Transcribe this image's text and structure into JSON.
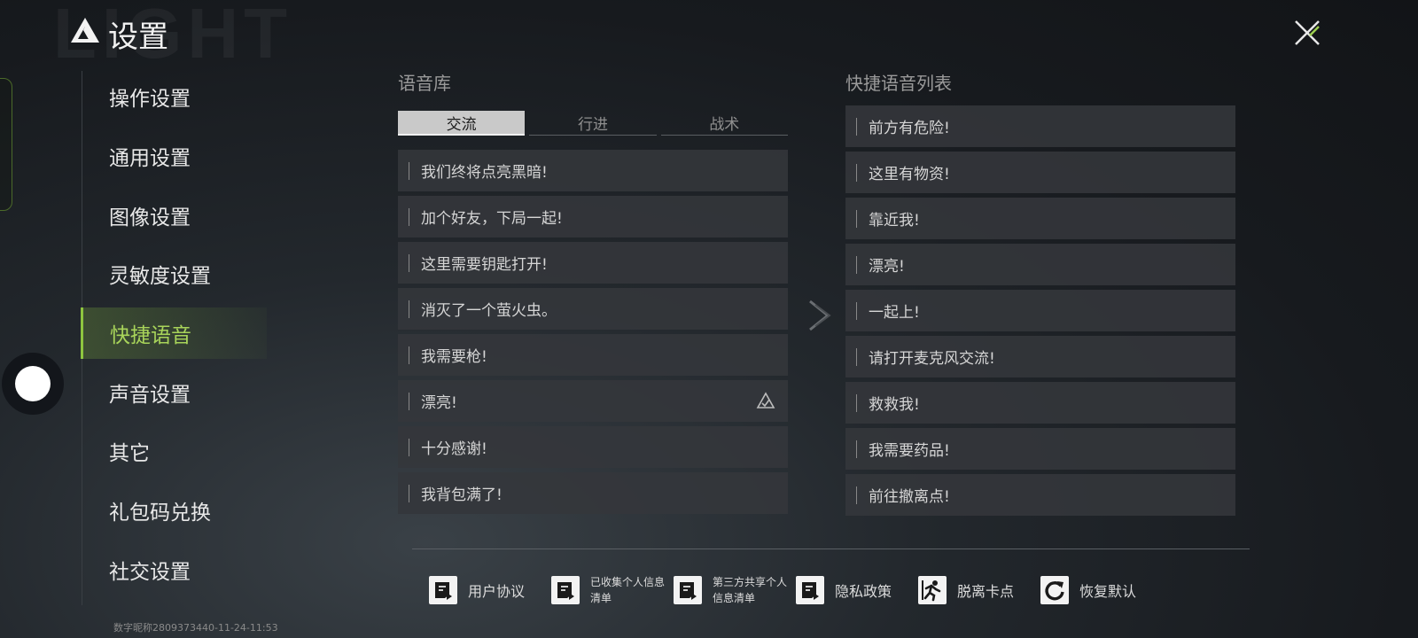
{
  "header": {
    "title": "设置",
    "watermark": "LIGHT",
    "logo_icon": "triangle-logo-icon",
    "close_icon": "close-icon"
  },
  "sidebar": {
    "items": [
      {
        "label": "操作设置",
        "active": false
      },
      {
        "label": "通用设置",
        "active": false
      },
      {
        "label": "图像设置",
        "active": false
      },
      {
        "label": "灵敏度设置",
        "active": false
      },
      {
        "label": "快捷语音",
        "active": true
      },
      {
        "label": "声音设置",
        "active": false
      },
      {
        "label": "其它",
        "active": false
      },
      {
        "label": "礼包码兑换",
        "active": false
      },
      {
        "label": "社交设置",
        "active": false
      }
    ]
  },
  "library": {
    "title": "语音库",
    "tabs": [
      {
        "label": "交流",
        "active": true
      },
      {
        "label": "行进",
        "active": false
      },
      {
        "label": "战术",
        "active": false
      }
    ],
    "items": [
      {
        "text": "我们终将点亮黑暗!"
      },
      {
        "text": "加个好友，下局一起!"
      },
      {
        "text": "这里需要钥匙打开!"
      },
      {
        "text": "消灭了一个萤火虫。"
      },
      {
        "text": "我需要枪!"
      },
      {
        "text": "漂亮!",
        "marked": true
      },
      {
        "text": "十分感谢!"
      },
      {
        "text": "我背包满了!"
      }
    ]
  },
  "quick_list": {
    "title": "快捷语音列表",
    "items": [
      {
        "text": "前方有危险!"
      },
      {
        "text": "这里有物资!"
      },
      {
        "text": "靠近我!"
      },
      {
        "text": "漂亮!"
      },
      {
        "text": "一起上!"
      },
      {
        "text": "请打开麦克风交流!"
      },
      {
        "text": "救救我!"
      },
      {
        "text": "我需要药品!"
      },
      {
        "text": "前往撤离点!"
      }
    ]
  },
  "bottom": {
    "user_agreement": "用户协议",
    "collected_info": "已收集个人信息清单",
    "third_party_info": "第三方共享个人信息清单",
    "privacy_policy": "隐私政策",
    "unstuck": "脱离卡点",
    "restore_default": "恢复默认"
  },
  "footer": {
    "id_text": "数字昵称2809373440-11-24-11:53"
  },
  "colors": {
    "accent": "#8ec63f",
    "row_bg": "#34373b",
    "tab_active": "#c9c9c9"
  }
}
